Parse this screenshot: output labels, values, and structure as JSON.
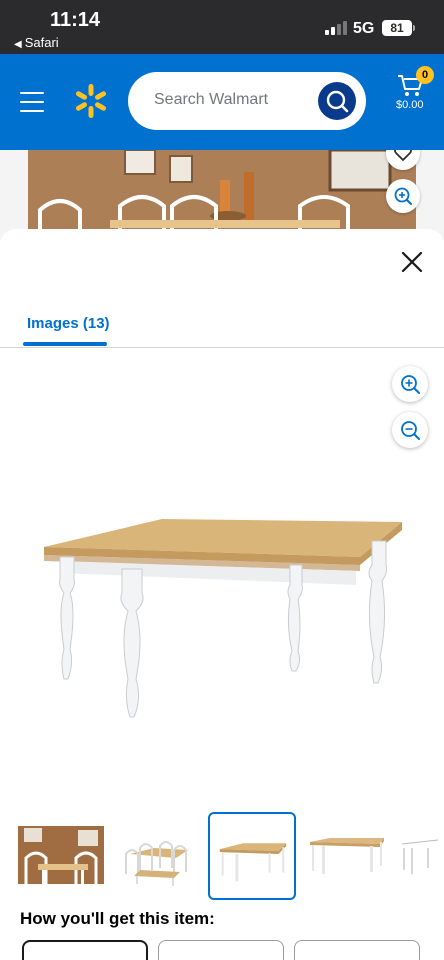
{
  "status_bar": {
    "time": "11:14",
    "back_app": "Safari",
    "network": "5G",
    "battery": "81"
  },
  "header": {
    "search_placeholder": "Search Walmart",
    "cart_count": "0",
    "cart_total": "$0.00"
  },
  "colors": {
    "walmart_blue": "#0071ce",
    "spark_yellow": "#ffc220",
    "search_button": "#0a3a8c"
  },
  "icons": [
    "menu-icon",
    "walmart-spark-icon",
    "search-icon",
    "cart-icon",
    "heart-icon",
    "zoom-in-icon",
    "zoom-out-icon",
    "close-icon"
  ],
  "modal": {
    "tab_label": "Images (13)",
    "thumbnails": [
      "table-dining-room-photo",
      "table-set-with-chairs-and-bench",
      "table-natural-white",
      "table-alternate-angle",
      "table-dimensions-diagram"
    ],
    "selected_thumbnail": "table-natural-white"
  },
  "fulfillment": {
    "heading": "How you'll get this item:"
  }
}
